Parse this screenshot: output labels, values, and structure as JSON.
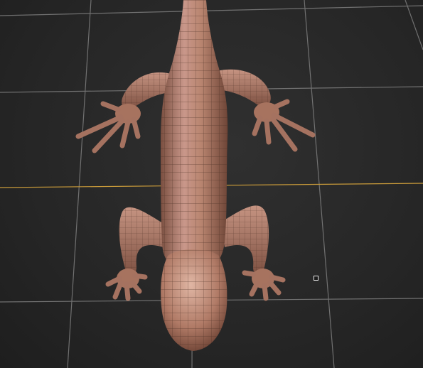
{
  "viewport": {
    "background": "#2a2a2a",
    "grid_color": "#8a8a8a",
    "horizon_axis_color": "#c89a3a",
    "model": {
      "name": "lizard-mesh",
      "skin_color": "#b98570",
      "wire_color": "#4a2e24"
    }
  }
}
